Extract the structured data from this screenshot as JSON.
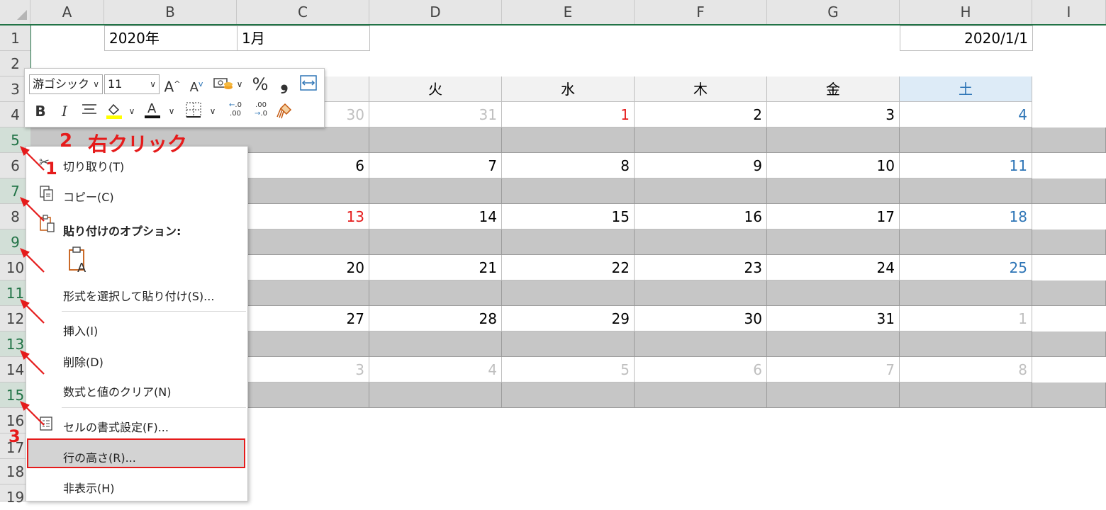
{
  "columns": [
    "A",
    "B",
    "C",
    "D",
    "E",
    "F",
    "G",
    "H",
    "I"
  ],
  "rows": [
    "1",
    "2",
    "3",
    "4",
    "5",
    "6",
    "7",
    "8",
    "9",
    "10",
    "11",
    "12",
    "13",
    "14",
    "15",
    "16",
    "17",
    "18",
    "19"
  ],
  "cells": {
    "b1": "2020年",
    "c1": "1月",
    "h1": "2020/1/1"
  },
  "weekdays": [
    "火",
    "水",
    "木",
    "金",
    "土"
  ],
  "calendar": {
    "week1": [
      "30",
      "31",
      "1",
      "2",
      "3",
      "4"
    ],
    "week2": [
      "6",
      "7",
      "8",
      "9",
      "10",
      "11"
    ],
    "week3": [
      "13",
      "14",
      "15",
      "16",
      "17",
      "18"
    ],
    "week4": [
      "20",
      "21",
      "22",
      "23",
      "24",
      "25"
    ],
    "week5": [
      "27",
      "28",
      "29",
      "30",
      "31",
      "1"
    ],
    "week6": [
      "3",
      "4",
      "5",
      "6",
      "7",
      "8"
    ]
  },
  "mini_toolbar": {
    "font_name": "游ゴシック",
    "font_size": "11",
    "bold": "B",
    "italic": "I",
    "percent": "%",
    "comma": "❟",
    "inc_decimal": "←.0 .00",
    "dec_decimal": ".00 →.0"
  },
  "context_menu": {
    "cut": "切り取り(T)",
    "copy": "コピー(C)",
    "paste_options": "貼り付けのオプション:",
    "paste_special": "形式を選択して貼り付け(S)...",
    "insert": "挿入(I)",
    "delete": "削除(D)",
    "clear": "数式と値のクリア(N)",
    "format_cells": "セルの書式設定(F)...",
    "row_height": "行の高さ(R)...",
    "hide": "非表示(H)"
  },
  "annotations": {
    "n1": "1",
    "n2": "2",
    "right_click": "右クリック",
    "n3": "3"
  },
  "colors": {
    "red": "#e51b1b",
    "saturday": "#2e75b6",
    "gray_text": "#bfbfbf",
    "excel_green": "#217346"
  },
  "icons": {
    "cut": "scissors-icon",
    "copy": "copy-icon",
    "paste": "paste-icon",
    "format": "format-cells-icon",
    "painter": "format-painter-icon"
  }
}
